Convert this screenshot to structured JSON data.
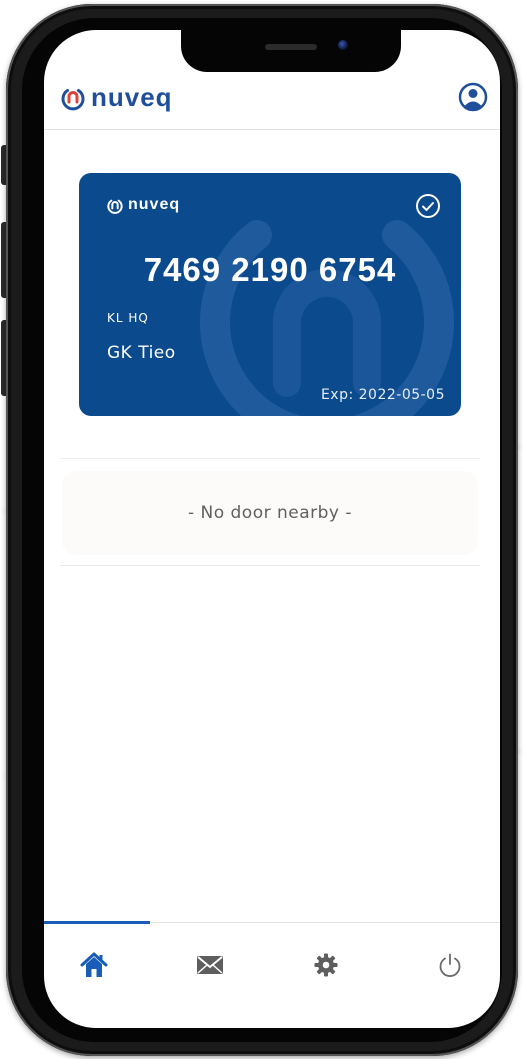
{
  "app": {
    "brand_name": "nuveq",
    "brand_color": "#1f4f9a",
    "accent_color": "#1a5db8",
    "card_color": "#0c4a8e"
  },
  "header": {
    "logo_text": "nuveq",
    "profile_icon": "user-circle-icon"
  },
  "card": {
    "logo_text": "nuveq",
    "status_icon": "check-circle-icon",
    "number": "7469 2190 6754",
    "site": "KL HQ",
    "holder": "GK Tieo",
    "expiry": "Exp: 2022-05-05"
  },
  "door": {
    "status_text": "- No door nearby -"
  },
  "nav": {
    "items": [
      {
        "icon": "home-icon",
        "active": true
      },
      {
        "icon": "envelope-icon",
        "active": false
      },
      {
        "icon": "gear-icon",
        "active": false
      },
      {
        "icon": "power-icon",
        "active": false
      }
    ]
  }
}
